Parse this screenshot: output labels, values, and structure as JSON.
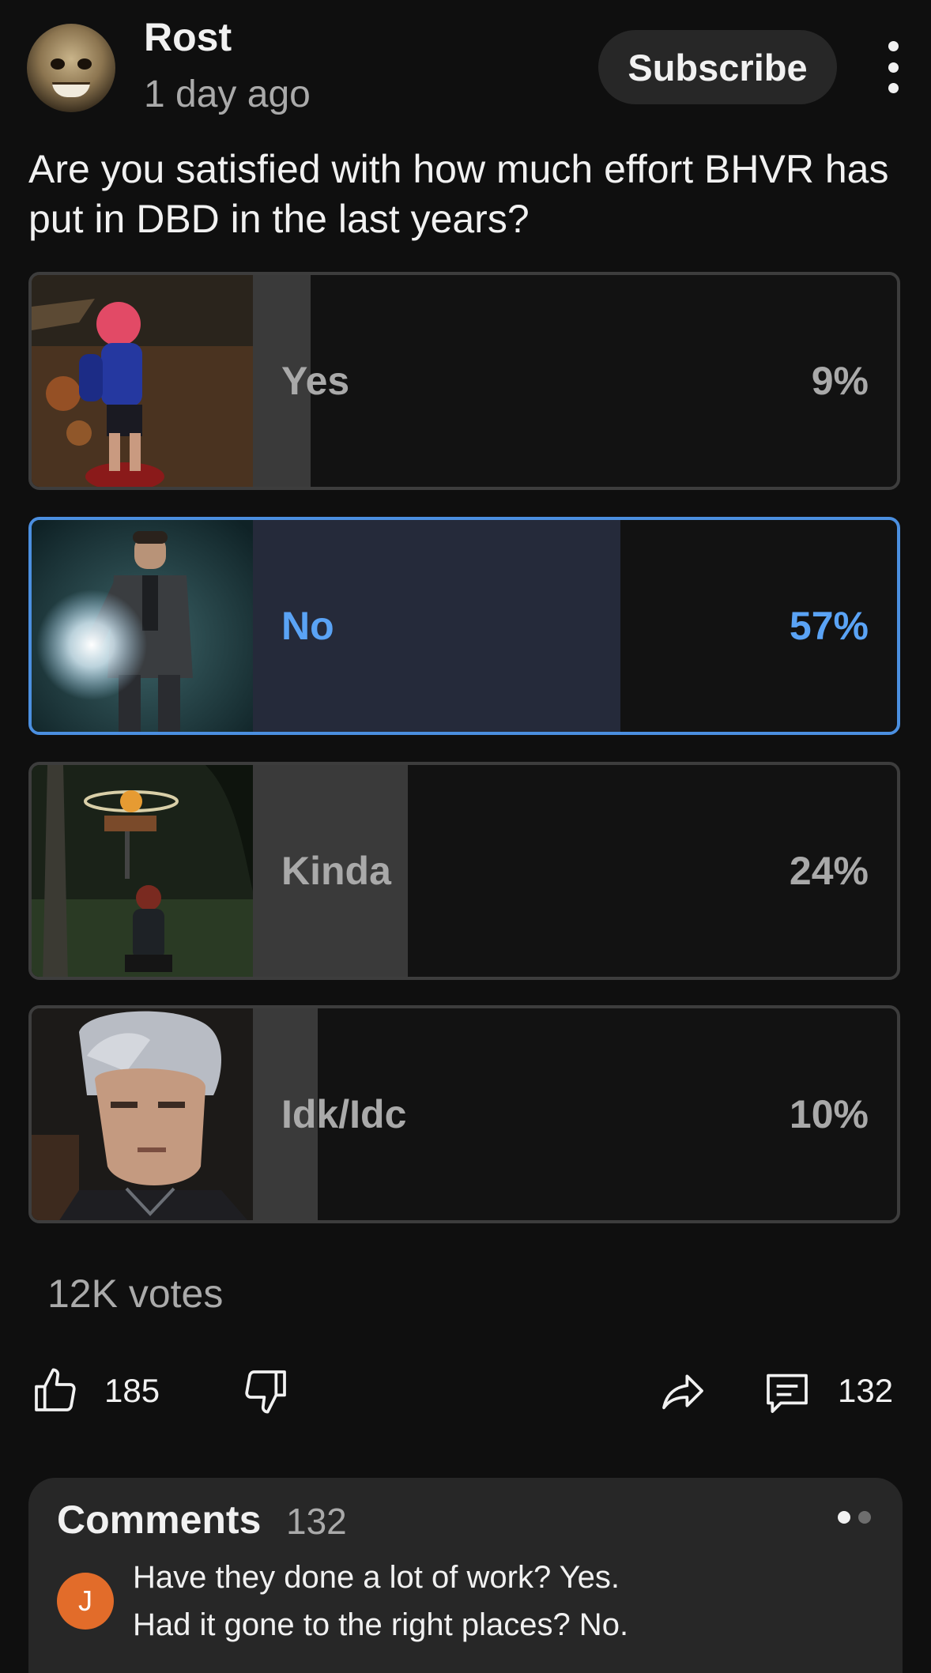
{
  "post": {
    "channel_name": "Rost",
    "time": "1 day ago",
    "subscribe_label": "Subscribe",
    "question": "Are you satisfied with how much effort BHVR has put in DBD in the last years?"
  },
  "poll": {
    "options": [
      {
        "label": "Yes",
        "percent_text": "9%",
        "percent": 9,
        "selected": false
      },
      {
        "label": "No",
        "percent_text": "57%",
        "percent": 57,
        "selected": true
      },
      {
        "label": "Kinda",
        "percent_text": "24%",
        "percent": 24,
        "selected": false
      },
      {
        "label": "Idk/Idc",
        "percent_text": "10%",
        "percent": 10,
        "selected": false
      }
    ],
    "votes": "12K votes"
  },
  "actions": {
    "likes": "185",
    "comments": "132"
  },
  "comments": {
    "title": "Comments",
    "count": "132",
    "top_comment": {
      "avatar_letter": "J",
      "text": "Have they done a lot of work? Yes.\nHad it gone to the right places? No."
    }
  },
  "colors": {
    "background": "#0f0f0f",
    "accent": "#4b8fe0",
    "selected_text": "#5aa3f5",
    "comment_avatar": "#e26c2a"
  },
  "icons": [
    "channel-avatar",
    "more-vert-icon",
    "thumb-up-icon",
    "thumb-down-icon",
    "share-icon",
    "comment-icon"
  ]
}
